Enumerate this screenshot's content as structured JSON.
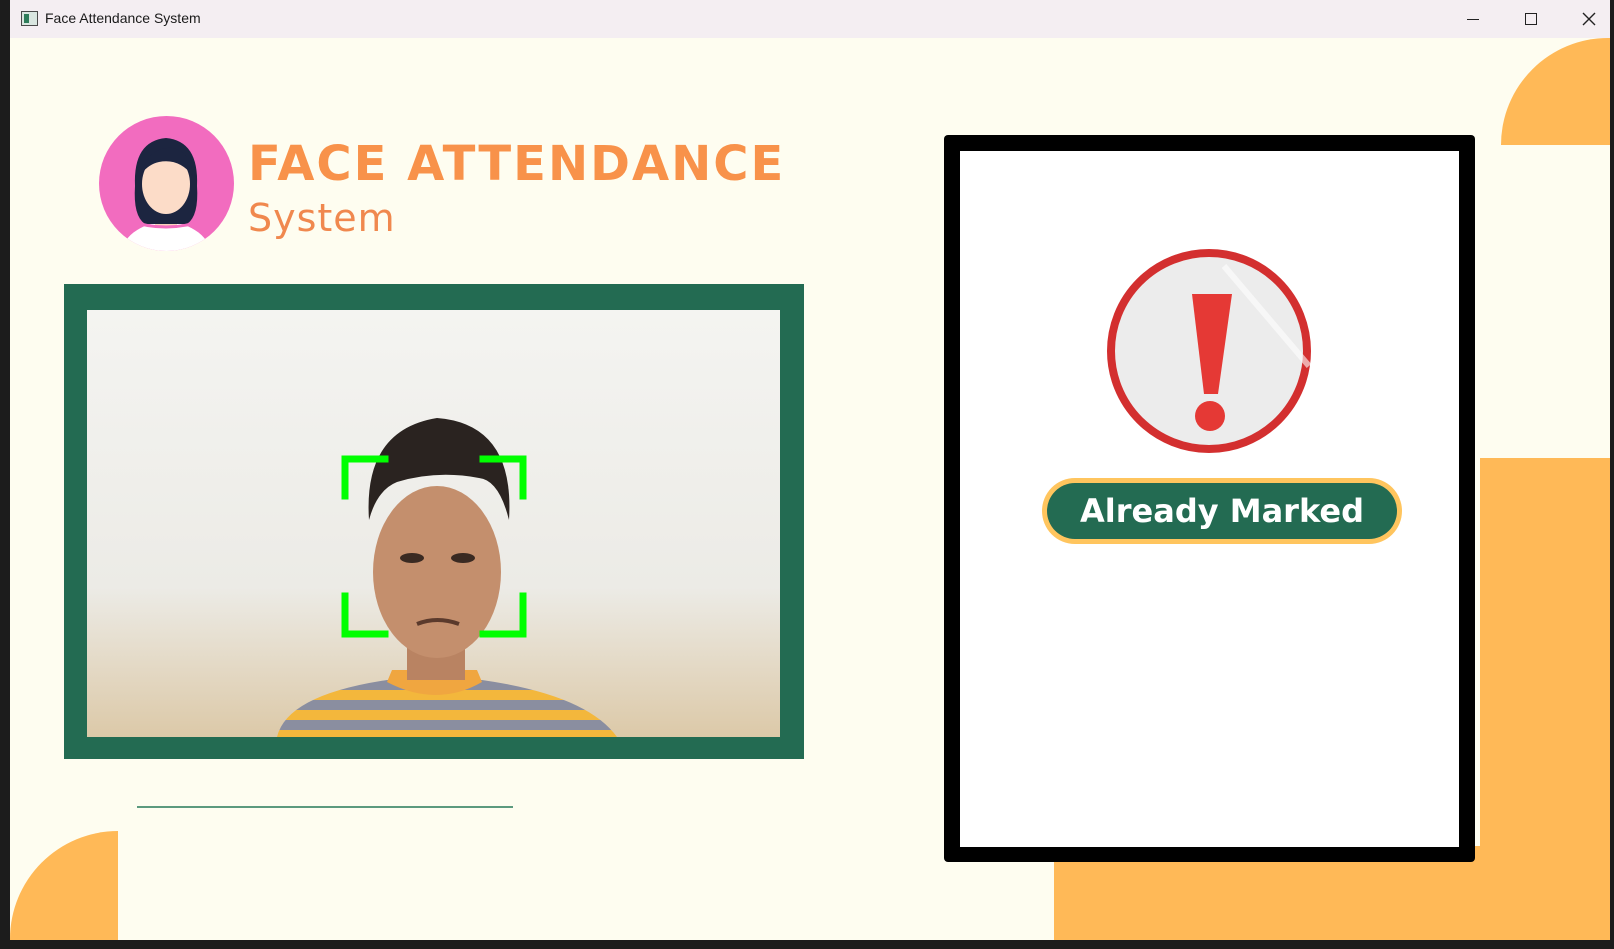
{
  "window": {
    "title": "Face Attendance System",
    "controls": [
      "minimize",
      "maximize",
      "close"
    ]
  },
  "header": {
    "brand_title": "FACE ATTENDANCE",
    "brand_subtitle": "System",
    "avatar_icon": "user-avatar-icon"
  },
  "camera": {
    "frame_color": "#236b52",
    "detection_color": "#00ff00"
  },
  "status": {
    "icon": "warning-exclamation-icon",
    "label": "Already Marked",
    "badge_color": "#236b52",
    "badge_border": "#ffc55e"
  },
  "colors": {
    "background": "#fefdf0",
    "accent_orange": "#ffb957",
    "brand_orange": "#f8924a",
    "avatar_pink": "#f26cbf",
    "warning_red": "#d32f2f"
  }
}
